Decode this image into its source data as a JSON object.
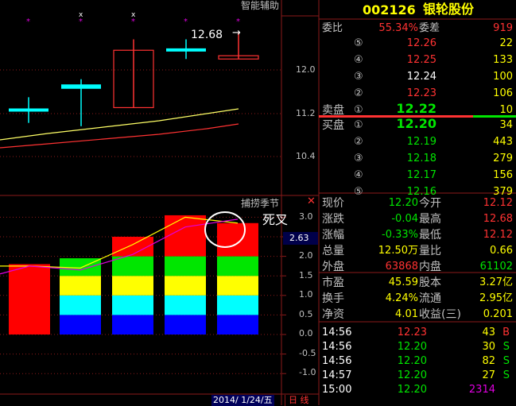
{
  "header": {
    "code": "002126",
    "name": "银轮股份",
    "indicator_main": "智能辅助",
    "indicator_sub": "捕捞季节"
  },
  "price_chart": {
    "axis_labels": [
      "12.0",
      "11.2",
      "10.4"
    ],
    "price_callout": "12.68",
    "candles": [
      {
        "open": 11.28,
        "close": 11.28,
        "high": 11.5,
        "low": 11.03
      },
      {
        "open": 11.72,
        "close": 11.64,
        "high": 11.83,
        "low": 10.97
      },
      {
        "open": 12.36,
        "close": 11.31,
        "high": 12.56,
        "low": 11.31
      },
      {
        "open": 12.38,
        "close": 12.38,
        "high": 12.56,
        "low": 12.2
      },
      {
        "open": 12.26,
        "close": 12.2,
        "high": 12.68,
        "low": 12.2
      }
    ]
  },
  "sub_chart": {
    "annotation": "死叉",
    "axis_labels": [
      "3.0",
      "2.5",
      "2.0",
      "1.5",
      "1.0",
      "0.5",
      "0.0",
      "-0.5",
      "-1.0"
    ],
    "current_value": "2.63",
    "bar_values": [
      1.8,
      1.95,
      2.5,
      3.05,
      2.85
    ],
    "line_a": [
      1.75,
      1.75,
      1.7,
      2.3,
      3.0,
      2.85
    ],
    "line_b": [
      1.55,
      1.75,
      1.65,
      2.05,
      2.75,
      2.95
    ],
    "date": "2014/ 1/24/五",
    "period_tab": "日 线"
  },
  "order_book": {
    "ratio_label": "委比",
    "ratio_value": "55.34%",
    "diff_label": "委差",
    "diff_value": "919",
    "asks": [
      {
        "level": "⑤",
        "price": "12.26",
        "vol": "22"
      },
      {
        "level": "④",
        "price": "12.25",
        "vol": "133"
      },
      {
        "level": "③",
        "price": "12.24",
        "vol": "100"
      },
      {
        "level": "②",
        "price": "12.23",
        "vol": "106"
      },
      {
        "level": "①",
        "price": "12.22",
        "vol": "10",
        "label": "卖盘"
      }
    ],
    "bids": [
      {
        "level": "①",
        "price": "12.20",
        "vol": "34",
        "label": "买盘"
      },
      {
        "level": "②",
        "price": "12.19",
        "vol": "443"
      },
      {
        "level": "③",
        "price": "12.18",
        "vol": "279"
      },
      {
        "level": "④",
        "price": "12.17",
        "vol": "156"
      },
      {
        "level": "⑤",
        "price": "12.16",
        "vol": "379"
      }
    ]
  },
  "quote": [
    {
      "l1": "现价",
      "v1": "12.20",
      "l2": "今开",
      "v2": "12.12"
    },
    {
      "l1": "涨跌",
      "v1": "-0.04",
      "l2": "最高",
      "v2": "12.68"
    },
    {
      "l1": "涨幅",
      "v1": "-0.33%",
      "l2": "最低",
      "v2": "12.12"
    },
    {
      "l1": "总量",
      "v1": "12.50万",
      "l2": "量比",
      "v2": "0.66"
    },
    {
      "l1": "外盘",
      "v1": "63868",
      "l2": "内盘",
      "v2": "61102"
    }
  ],
  "fundamentals": [
    {
      "l1": "市盈",
      "v1": "45.59",
      "l2": "股本",
      "v2": "3.27亿"
    },
    {
      "l1": "换手",
      "v1": "4.24%",
      "l2": "流通",
      "v2": "2.95亿"
    },
    {
      "l1": "净资",
      "v1": "4.01",
      "l2": "收益(三)",
      "v2": "0.201"
    }
  ],
  "ticks": [
    {
      "time": "14:56",
      "price": "12.23",
      "vol": "43",
      "side": "B"
    },
    {
      "time": "14:56",
      "price": "12.20",
      "vol": "30",
      "side": "S"
    },
    {
      "time": "14:56",
      "price": "12.20",
      "vol": "82",
      "side": "S"
    },
    {
      "time": "14:57",
      "price": "12.20",
      "vol": "27",
      "side": "S"
    },
    {
      "time": "15:00",
      "price": "12.20",
      "vol": "2314",
      "side": ""
    }
  ],
  "colors": {
    "up": "#ff3232",
    "down": "#00e600",
    "flat": "#ffffff",
    "label": "#c0c0c0",
    "yellow": "#ffff00",
    "cyan": "#00ffff",
    "grid": "#8b1a1a"
  }
}
